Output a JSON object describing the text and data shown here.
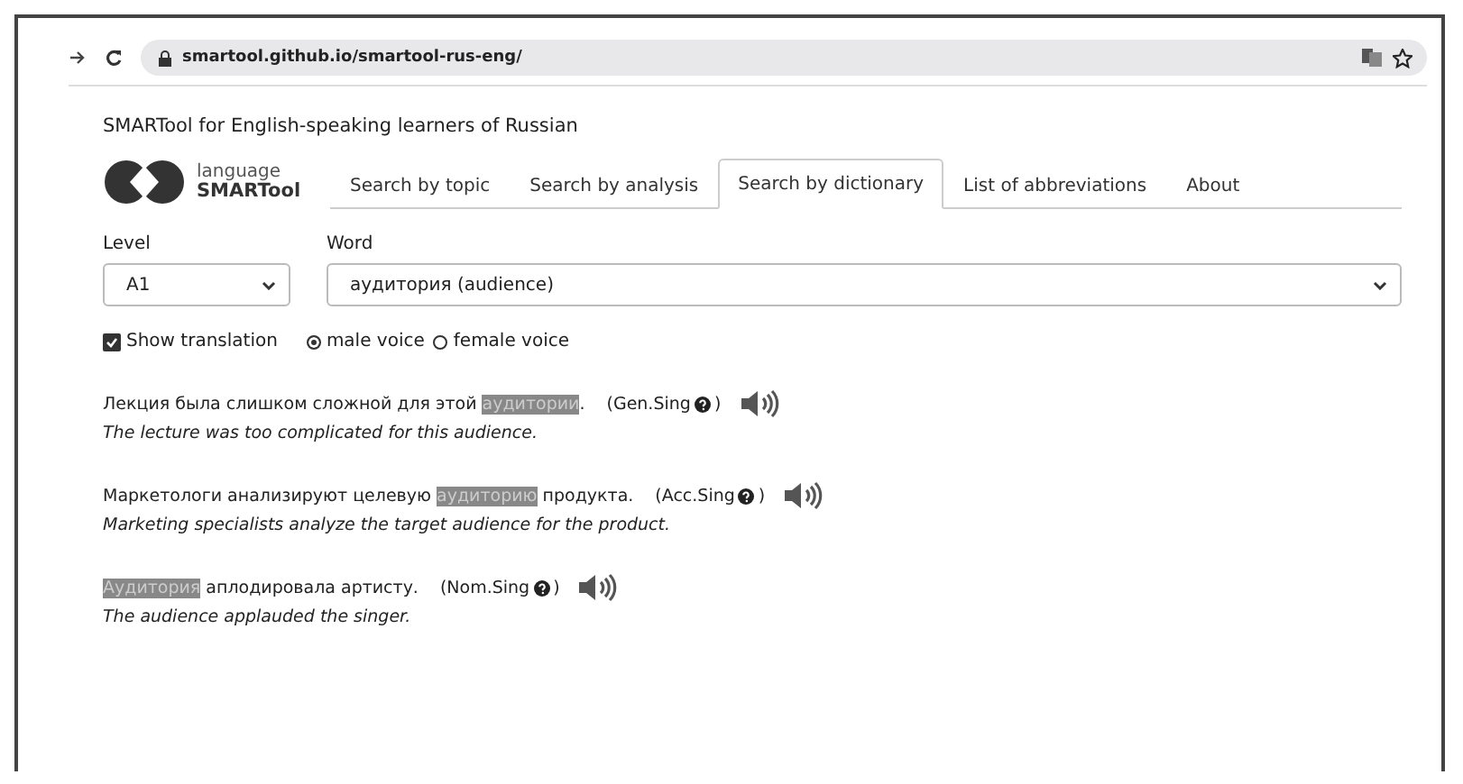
{
  "browser": {
    "url": "smartool.github.io/smartool-rus-eng/"
  },
  "heading": "SMARTool for English-speaking learners of Russian",
  "logo": {
    "top": "language",
    "bottom": "SMARTool"
  },
  "tabs": [
    {
      "label": "Search by topic",
      "selected": false
    },
    {
      "label": "Search by analysis",
      "selected": false
    },
    {
      "label": "Search by dictionary",
      "selected": true
    },
    {
      "label": "List of abbreviations",
      "selected": false
    },
    {
      "label": "About",
      "selected": false
    }
  ],
  "level": {
    "label": "Level",
    "value": "A1"
  },
  "word": {
    "label": "Word",
    "value": "аудитория (audience)"
  },
  "show_translation": {
    "label": "Show translation",
    "checked": true
  },
  "voices": [
    {
      "label": "male voice",
      "selected": true
    },
    {
      "label": "female voice",
      "selected": false
    }
  ],
  "examples": [
    {
      "before": "Лекция была слишком сложной для этой ",
      "highlight": "аудитории",
      "after": ".",
      "tag": "(Gen.Sing",
      "close": ")",
      "translation": "The lecture was too complicated for this audience."
    },
    {
      "before": "Маркетологи анализируют целевую ",
      "highlight": "аудиторию",
      "after": " продукта.",
      "tag": "(Acc.Sing",
      "close": ")",
      "translation": "Marketing specialists analyze the target audience for the product."
    },
    {
      "highlight": "Аудитория",
      "after": " аплодировала артисту.",
      "tag": "(Nom.Sing",
      "close": ")",
      "translation": "The audience applauded the singer."
    }
  ]
}
